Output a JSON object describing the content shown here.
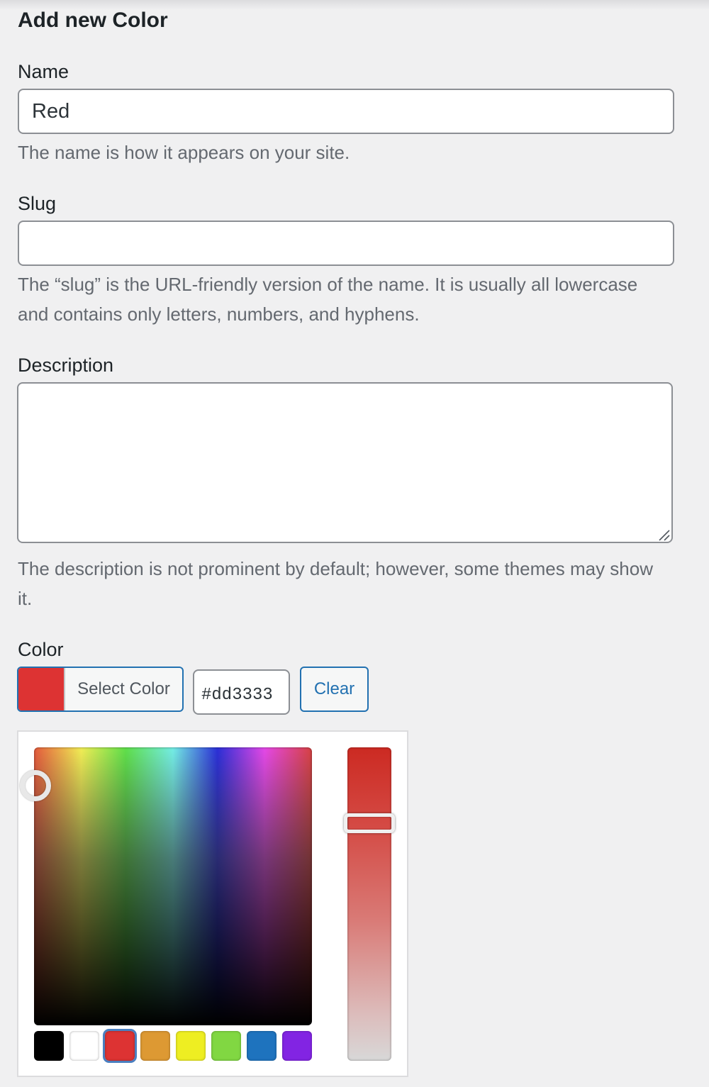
{
  "form": {
    "title": "Add new Color",
    "name": {
      "label": "Name",
      "value": "Red",
      "help": "The name is how it appears on your site."
    },
    "slug": {
      "label": "Slug",
      "value": "",
      "help": "The “slug” is the URL-friendly version of the name. It is usually all lowercase and contains only letters, numbers, and hyphens."
    },
    "description": {
      "label": "Description",
      "value": "",
      "help": "The description is not prominent by default; however, some themes may show it."
    },
    "color": {
      "label": "Color",
      "select_button_label": "Select Color",
      "hex_value": "#dd3333",
      "clear_button_label": "Clear",
      "current_color": "#dd3333",
      "palette": [
        {
          "name": "black",
          "hex": "#000000"
        },
        {
          "name": "white",
          "hex": "#ffffff"
        },
        {
          "name": "red",
          "hex": "#dd3333",
          "selected": true
        },
        {
          "name": "orange",
          "hex": "#dd9933"
        },
        {
          "name": "yellow",
          "hex": "#eeee22"
        },
        {
          "name": "green",
          "hex": "#81d742"
        },
        {
          "name": "blue",
          "hex": "#1e73be"
        },
        {
          "name": "purple",
          "hex": "#8224e3"
        }
      ]
    }
  },
  "colors": {
    "accent": "#2271b1",
    "border": "#8c8f94",
    "help_text": "#646970"
  }
}
